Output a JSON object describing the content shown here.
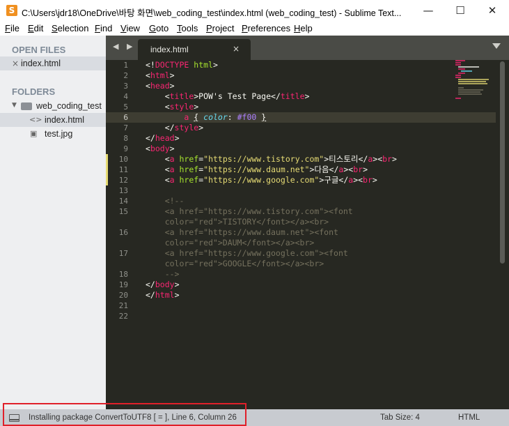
{
  "window": {
    "title": "C:\\Users\\jdr18\\OneDrive\\바탕 화면\\web_coding_test\\index.html (web_coding_test) - Sublime Text...",
    "app_icon": "sublime-text-icon",
    "minimize": "—",
    "maximize": "☐",
    "close": "✕"
  },
  "menu": [
    {
      "label": "File",
      "u": "F",
      "rest": "ile"
    },
    {
      "label": "Edit",
      "u": "E",
      "rest": "dit"
    },
    {
      "label": "Selection",
      "u": "S",
      "rest": "election"
    },
    {
      "label": "Find",
      "u": "F",
      "rest": "ind"
    },
    {
      "label": "View",
      "u": "V",
      "rest": "iew"
    },
    {
      "label": "Goto",
      "u": "G",
      "rest": "oto"
    },
    {
      "label": "Tools",
      "u": "T",
      "rest": "ools"
    },
    {
      "label": "Project",
      "u": "P",
      "rest": "roject"
    },
    {
      "label": "Preferences",
      "u": "P",
      "rest": "references"
    },
    {
      "label": "Help",
      "u": "H",
      "rest": "elp"
    }
  ],
  "sidebar": {
    "open_files_heading": "OPEN FILES",
    "open_file": {
      "close_glyph": "×",
      "name": "index.html"
    },
    "folders_heading": "FOLDERS",
    "folder": {
      "arrow": "▼",
      "name": "web_coding_test"
    },
    "files": [
      {
        "icon": "<>",
        "name": "index.html"
      },
      {
        "icon": "▣",
        "name": "test.jpg"
      }
    ]
  },
  "tabs": {
    "nav_arrows": "◀ ▶",
    "active_tab": "index.html",
    "close_glyph": "×"
  },
  "editor": {
    "line_numbers": [
      "1",
      "2",
      "3",
      "4",
      "5",
      "6",
      "7",
      "8",
      "9",
      "10",
      "11",
      "12",
      "13",
      "14",
      "15",
      "",
      "16",
      "",
      "17",
      "",
      "18",
      "19",
      "20",
      "21",
      "22"
    ],
    "current_line": "6",
    "modified_lines": [
      "10",
      "11",
      "12"
    ]
  },
  "statusbar": {
    "message": "Installing package ConvertToUTF8 [    =  ], Line 6, Column 26",
    "tab_size": "Tab Size: 4",
    "syntax": "HTML"
  }
}
